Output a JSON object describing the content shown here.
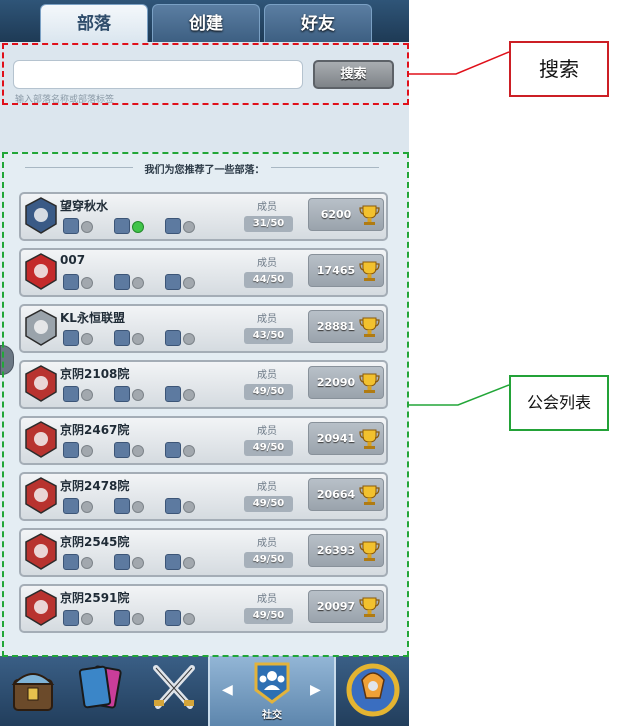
{
  "tabs": [
    "部落",
    "创建",
    "好友"
  ],
  "search": {
    "placeholder": "",
    "button_label": "搜索",
    "hint": "输入部落名称或部落标签"
  },
  "recommend_title": "我们为您推荐了一些部落：",
  "member_label": "成员",
  "clans": [
    {
      "name": "望穿秋水",
      "members": "31/50",
      "trophies": "6200",
      "online": true,
      "badge_color": "#3a5a86"
    },
    {
      "name": "007",
      "members": "44/50",
      "trophies": "17465",
      "online": false,
      "badge_color": "#c42a2a"
    },
    {
      "name": "KL永恒联盟",
      "members": "43/50",
      "trophies": "28881",
      "online": false,
      "badge_color": "#9aa3ab"
    },
    {
      "name": "京阴2108院",
      "members": "49/50",
      "trophies": "22090",
      "online": false,
      "badge_color": "#b8332f"
    },
    {
      "name": "京阴2467院",
      "members": "49/50",
      "trophies": "20941",
      "online": false,
      "badge_color": "#b8332f"
    },
    {
      "name": "京阴2478院",
      "members": "49/50",
      "trophies": "20664",
      "online": false,
      "badge_color": "#b8332f"
    },
    {
      "name": "京阴2545院",
      "members": "49/50",
      "trophies": "26393",
      "online": false,
      "badge_color": "#b8332f"
    },
    {
      "name": "京阴2591院",
      "members": "49/50",
      "trophies": "20097",
      "online": false,
      "badge_color": "#b8332f"
    }
  ],
  "bottom_nav": {
    "social_label": "社交",
    "items": [
      "chest-icon",
      "cards-icon",
      "battle-icon",
      "social-icon",
      "trophy-road-icon"
    ]
  },
  "annotations": {
    "search_label": "搜索",
    "list_label": "公会列表"
  },
  "colors": {
    "search_callout": "#e0101a",
    "list_callout": "#22a638"
  }
}
